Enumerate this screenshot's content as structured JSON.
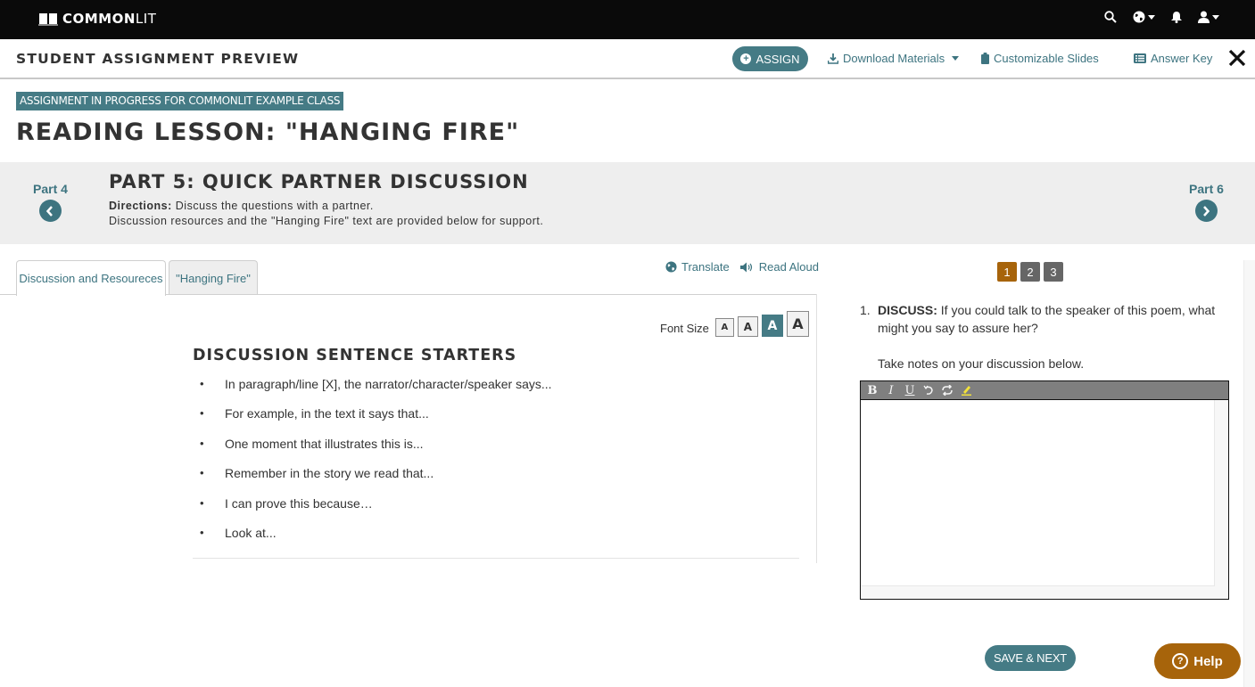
{
  "topbar": {
    "brand_bold": "COMMON",
    "brand_light": "LIT",
    "icons": [
      "search-icon",
      "globe-icon",
      "bell-icon",
      "user-icon"
    ]
  },
  "subheader": {
    "title": "STUDENT ASSIGNMENT PREVIEW",
    "assign_label": "ASSIGN",
    "download_label": "Download Materials",
    "slides_label": "Customizable Slides",
    "answer_key_label": "Answer Key"
  },
  "assignment": {
    "badge": "ASSIGNMENT IN PROGRESS FOR COMMONLIT EXAMPLE CLASS",
    "title": "READING LESSON: \"HANGING FIRE\""
  },
  "part": {
    "prev_label": "Part 4",
    "next_label": "Part 6",
    "title": "PART 5: QUICK PARTNER DISCUSSION",
    "directions_label": "Directions:",
    "directions_line1": "Discuss the questions with a partner.",
    "directions_line2": "Discussion resources and the \"Hanging Fire\" text are provided below for support."
  },
  "tabs": [
    {
      "label": "Discussion and Resoureces",
      "active": true
    },
    {
      "label": "\"Hanging Fire\"",
      "active": false
    }
  ],
  "tools": {
    "translate_label": "Translate",
    "read_aloud_label": "Read Aloud",
    "font_size_label": "Font Size",
    "font_sizes": [
      "A",
      "A",
      "A",
      "A"
    ],
    "font_size_selected_index": 2
  },
  "starters": {
    "heading": "DISCUSSION SENTENCE STARTERS",
    "items": [
      "In paragraph/line [X], the narrator/character/speaker says...",
      "For example, in the text it says that...",
      "One moment that illustrates this is...",
      "Remember in the story we read that...",
      "I can prove this because…",
      "Look at..."
    ]
  },
  "questions": {
    "pages": [
      "1",
      "2",
      "3"
    ],
    "current_page": "1",
    "colors": {
      "active": "#a7640b",
      "inactive": "#666666"
    },
    "number": "1.",
    "label": "DISCUSS:",
    "text": "If you could talk to the speaker of this poem, what might you say to assure her?",
    "notes_prompt": "Take notes on your discussion below."
  },
  "editor": {
    "toolbar": [
      "bold-icon",
      "italic-icon",
      "underline-icon",
      "undo-icon",
      "redo-icon",
      "highlight-icon"
    ],
    "value": ""
  },
  "footer": {
    "save_next_label": "SAVE & NEXT",
    "help_label": "Help"
  },
  "colors": {
    "teal": "#457b85",
    "link_teal": "#3d7480",
    "help_orange": "#a7640b",
    "topbar": "#0a0a0a"
  }
}
